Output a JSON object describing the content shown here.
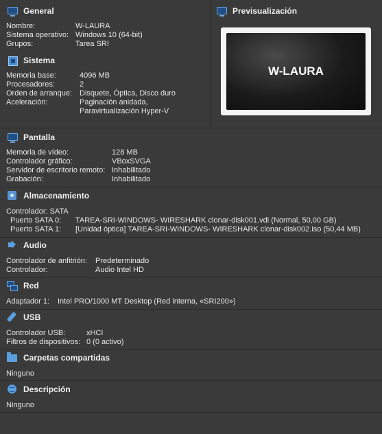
{
  "general": {
    "title": "General",
    "rows": [
      {
        "label": "Nombre:",
        "value": "W-LAURA"
      },
      {
        "label": "Sistema operativo:",
        "value": "Windows 10 (64-bit)"
      },
      {
        "label": "Grupos:",
        "value": "Tarea SRI"
      }
    ]
  },
  "preview": {
    "title": "Previsualización",
    "screen_text": "W-LAURA"
  },
  "sistema": {
    "title": "Sistema",
    "rows": [
      {
        "label": "Memoria base:",
        "value": "4096 MB"
      },
      {
        "label": "Procesadores:",
        "value": "2"
      },
      {
        "label": "Orden de arranque:",
        "value": "Disquete, Óptica, Disco duro"
      },
      {
        "label": "Aceleración:",
        "value": "Paginación anidada,"
      },
      {
        "label": "",
        "value": "Paravirtualización Hyper-V"
      }
    ]
  },
  "pantalla": {
    "title": "Pantalla",
    "rows": [
      {
        "label": "Memoria de vídeo:",
        "value": "128 MB"
      },
      {
        "label": "Controlador gráfico:",
        "value": "VBoxSVGA"
      },
      {
        "label": "Servidor de escritorio remoto:",
        "value": "Inhabilitado"
      },
      {
        "label": "Grabación:",
        "value": "Inhabilitado"
      }
    ]
  },
  "almacenamiento": {
    "title": "Almacenamiento",
    "controller": "Controlador: SATA",
    "rows": [
      {
        "label": "Puerto SATA 0:",
        "value": "TAREA-SRI-WINDOWS- WIRESHARK clonar-disk001.vdi (Normal, 50,00 GB)"
      },
      {
        "label": "Puerto SATA 1:",
        "value": "[Unidad óptica] TAREA-SRI-WINDOWS- WIRESHARK clonar-disk002.iso (50,44 MB)"
      }
    ]
  },
  "audio": {
    "title": "Audio",
    "rows": [
      {
        "label": "Controlador de anfitrión:",
        "value": "Predeterminado"
      },
      {
        "label": "Controlador:",
        "value": "Audio Intel HD"
      }
    ]
  },
  "red": {
    "title": "Red",
    "rows": [
      {
        "label": "Adaptador 1:",
        "value": "Intel PRO/1000 MT Desktop (Red interna, «SRI200»)"
      }
    ]
  },
  "usb": {
    "title": "USB",
    "rows": [
      {
        "label": "Controlador USB:",
        "value": "xHCI"
      },
      {
        "label": "Filtros de dispositivos:",
        "value": "0 (0 activo)"
      }
    ]
  },
  "carpetas": {
    "title": "Carpetas compartidas",
    "value": "Ninguno"
  },
  "descripcion": {
    "title": "Descripción",
    "value": "Ninguno"
  }
}
